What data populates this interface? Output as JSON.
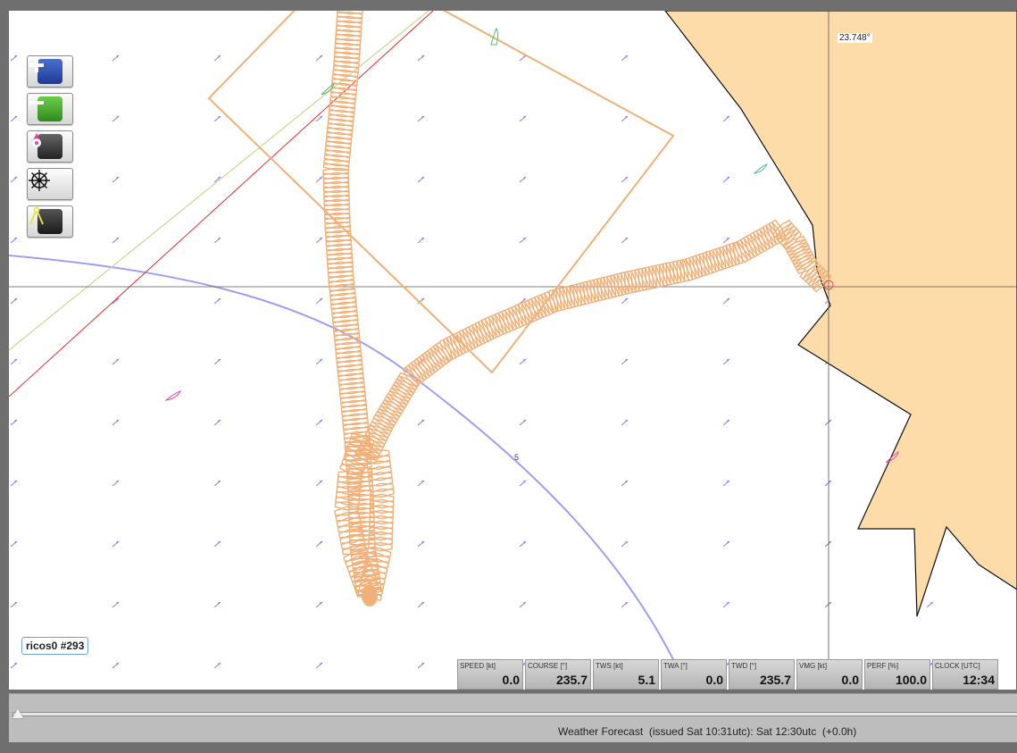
{
  "map": {
    "cursor_lon_readout": "23.748°",
    "isoline_label": "5",
    "boat_label": "ricos0 #293"
  },
  "controls": [
    {
      "name": "zoom-in-button",
      "icon": "plus-icon"
    },
    {
      "name": "zoom-out-button",
      "icon": "minus-icon"
    },
    {
      "name": "center-boat-button",
      "icon": "compass-pin-icon"
    },
    {
      "name": "helm-button",
      "icon": "ship-wheel-icon"
    },
    {
      "name": "measure-button",
      "icon": "dividers-icon"
    }
  ],
  "instruments": [
    {
      "label": "SPEED [kt]",
      "value": "0.0"
    },
    {
      "label": "COURSE [°]",
      "value": "235.7"
    },
    {
      "label": "TWS [kt]",
      "value": "5.1"
    },
    {
      "label": "TWA [°]",
      "value": "0.0"
    },
    {
      "label": "TWD [°]",
      "value": "235.7"
    },
    {
      "label": "VMG [kt]",
      "value": "0.0"
    },
    {
      "label": "PERF [%]",
      "value": "100.0"
    },
    {
      "label": "CLOCK [UTC]",
      "value": "12:34"
    }
  ],
  "timebar": {
    "forecast_text": "Weather Forecast  (issued Sat 10:31utc): Sat 12:30utc  (+0.0h)",
    "slider_position": 0
  },
  "colors": {
    "land": "#fddcaa",
    "track": "#f0b078",
    "isoline": "#9e9ef2",
    "rhumb_red": "#e03030",
    "rhumb_green": "#c8d890",
    "wind_arrow": "#8a7ae0"
  }
}
